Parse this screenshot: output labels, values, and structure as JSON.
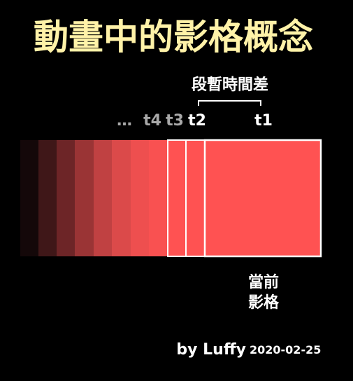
{
  "title": "動畫中的影格概念",
  "interval_label": "段暫時間差",
  "frame_labels": [
    "…",
    "t4",
    "t3",
    "t2",
    "t1"
  ],
  "current_frame_label": [
    "當前",
    "影格"
  ],
  "credit": {
    "author": "by Luffy",
    "date": "2020-02-25"
  },
  "colors": {
    "background": "#000000",
    "title": "#FFF2A8",
    "frame_current": "#FF5252",
    "frame_trail": [
      "#140809",
      "#3F1718",
      "#6D2527",
      "#9A3435",
      "#C04142",
      "#DB4A4A",
      "#EE4F4F",
      "#F95151",
      "#FF5252",
      "#FF5252"
    ],
    "frame_border": "#FFFFFF",
    "text_white": "#FFFFFF",
    "text_grey": "#A8A8A8"
  }
}
